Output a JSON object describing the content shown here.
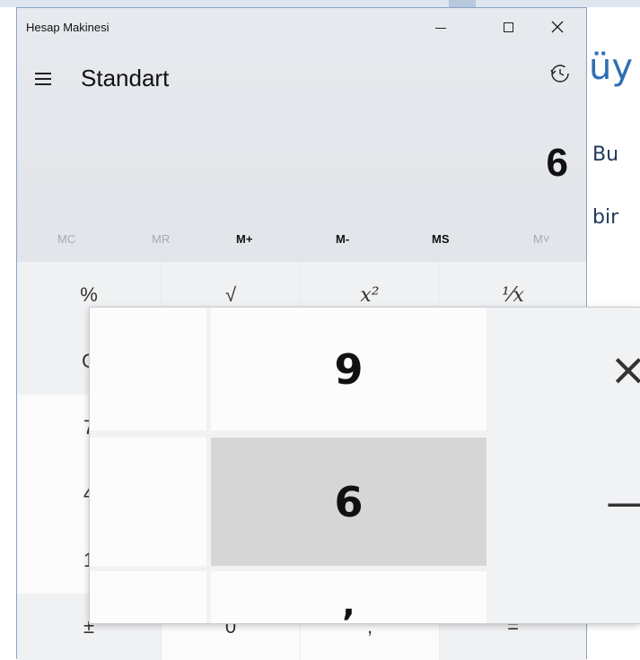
{
  "background_document": {
    "heading": "üy",
    "lines": [
      "Bu",
      "bir"
    ]
  },
  "window": {
    "title": "Hesap Makinesi",
    "minimize_glyph": "–",
    "maximize_glyph": "☐",
    "close_glyph": "✕"
  },
  "header": {
    "mode": "Standart",
    "menu_icon": "hamburger-icon",
    "history_icon": "history-icon"
  },
  "display": {
    "value": "6"
  },
  "memory": {
    "buttons": [
      {
        "label": "MC",
        "enabled": false
      },
      {
        "label": "MR",
        "enabled": false
      },
      {
        "label": "M+",
        "enabled": true
      },
      {
        "label": "M-",
        "enabled": true
      },
      {
        "label": "MS",
        "enabled": true
      },
      {
        "label": "M˅",
        "enabled": false
      }
    ]
  },
  "keys": {
    "row_fn": [
      "%",
      "√",
      "x²",
      "⅟x"
    ],
    "row2": [
      "C",
      "",
      "",
      ""
    ],
    "row3": [
      "7",
      "",
      "",
      ""
    ],
    "row4": [
      "4",
      "",
      "",
      ""
    ],
    "row5": [
      "1",
      "",
      "",
      ""
    ],
    "row6": [
      "±",
      "0",
      ",",
      "="
    ]
  },
  "magnifier": {
    "nine": "9",
    "times": "×",
    "six": "6",
    "minus": "—",
    "comma": ","
  }
}
